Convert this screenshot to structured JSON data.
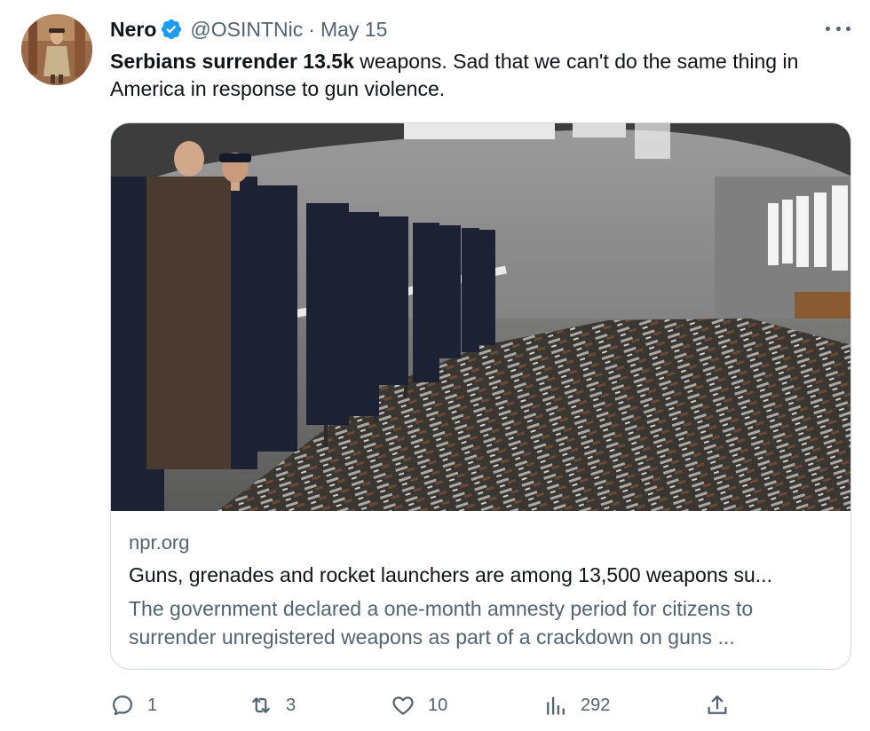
{
  "author": {
    "name": "Nero",
    "handle": "@OSINTNic",
    "separator": "·",
    "date": "May 15",
    "verified": true,
    "avatar_icon": "avatar-icon"
  },
  "tweet": {
    "text_bold": "Serbians surrender 13.5k",
    "text_rest": " weapons. Sad that we can't do the same thing in America in response to gun violence."
  },
  "card": {
    "image_description_icon": "news-photo",
    "domain": "npr.org",
    "title": "Guns, grenades and rocket launchers are among 13,500 weapons su...",
    "description": "The government declared a one-month amnesty period for citizens to surrender unregistered weapons as part of a crackdown on guns ..."
  },
  "actions": {
    "replies": "1",
    "reposts": "3",
    "likes": "10",
    "views": "292"
  },
  "colors": {
    "text": "#0f1419",
    "secondary": "#536471",
    "verified": "#1d9bf0",
    "border": "#cfd9de"
  }
}
